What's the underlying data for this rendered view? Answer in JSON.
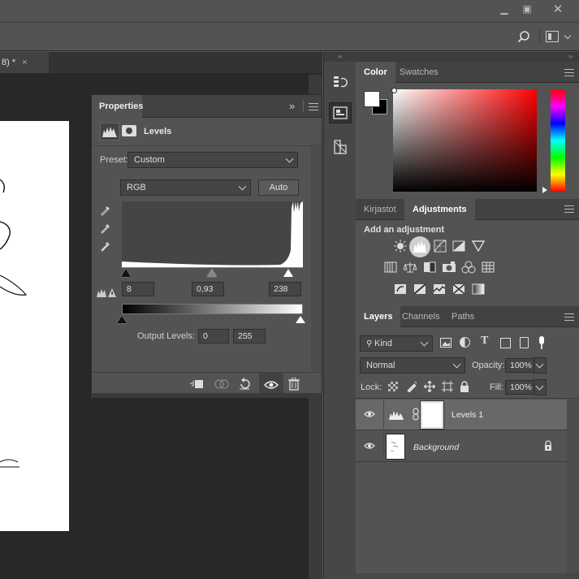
{
  "window": {
    "minimize_icon": "minimize-icon",
    "restore_icon": "restore-icon",
    "close_icon": "close-icon"
  },
  "document": {
    "tab_label": "8) *",
    "tab_close": "×"
  },
  "properties": {
    "tab_label": "Properties",
    "collapse_glyph": "»",
    "title": "Levels",
    "preset_label": "Preset:",
    "preset_value": "Custom",
    "channel_value": "RGB",
    "auto_label": "Auto",
    "input_shadow": "8",
    "input_midtone": "0,93",
    "input_highlight": "238",
    "output_label": "Output Levels:",
    "output_low": "0",
    "output_high": "255"
  },
  "color_panel": {
    "tabs": [
      "Color",
      "Swatches"
    ],
    "foreground": "#ffffff",
    "background": "#000000"
  },
  "adjustments_panel": {
    "tabs": [
      "Kirjastot",
      "Adjustments"
    ],
    "heading": "Add an adjustment"
  },
  "layers_panel": {
    "tabs": [
      "Layers",
      "Channels",
      "Paths"
    ],
    "filter_label": "Kind",
    "blend_mode": "Normal",
    "opacity_label": "Opacity:",
    "opacity_value": "100%",
    "lock_label": "Lock:",
    "fill_label": "Fill:",
    "fill_value": "100%",
    "layers": [
      {
        "name": "Levels 1"
      },
      {
        "name": "Background"
      }
    ]
  }
}
